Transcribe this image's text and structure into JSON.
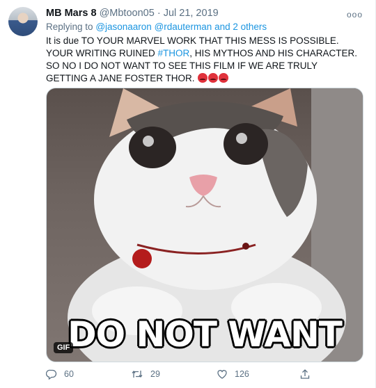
{
  "tweet": {
    "name": "MB Mars 8",
    "handle": "@Mbtoon05",
    "separator": "·",
    "date": "Jul 21, 2019",
    "more": "ooo",
    "reply_prefix": "Replying to",
    "reply_users": "@jasonaaron @rdauterman",
    "reply_and": "and",
    "reply_others": "2 others",
    "text_part1": "It is due TO YOUR MARVEL WORK THAT THIS MESS IS POSSIBLE. YOUR WRITING RUINED",
    "hashtag": "#THOR",
    "text_part2": ", HIS MYTHOS AND HIS CHARACTER. SO NO I DO NOT WANT TO SEE THIS FILM IF WE ARE TRULY GETTING A JANE FOSTER THOR.",
    "emojis": [
      "angry-face-icon",
      "angry-face-icon",
      "angry-face-icon"
    ]
  },
  "media": {
    "caption": "DO NOT WANT",
    "badge": "GIF"
  },
  "actions": {
    "replies": "60",
    "retweets": "29",
    "likes": "126"
  },
  "colors": {
    "link": "#1b95e0",
    "secondary": "#5b7083",
    "text": "#0f1419"
  }
}
